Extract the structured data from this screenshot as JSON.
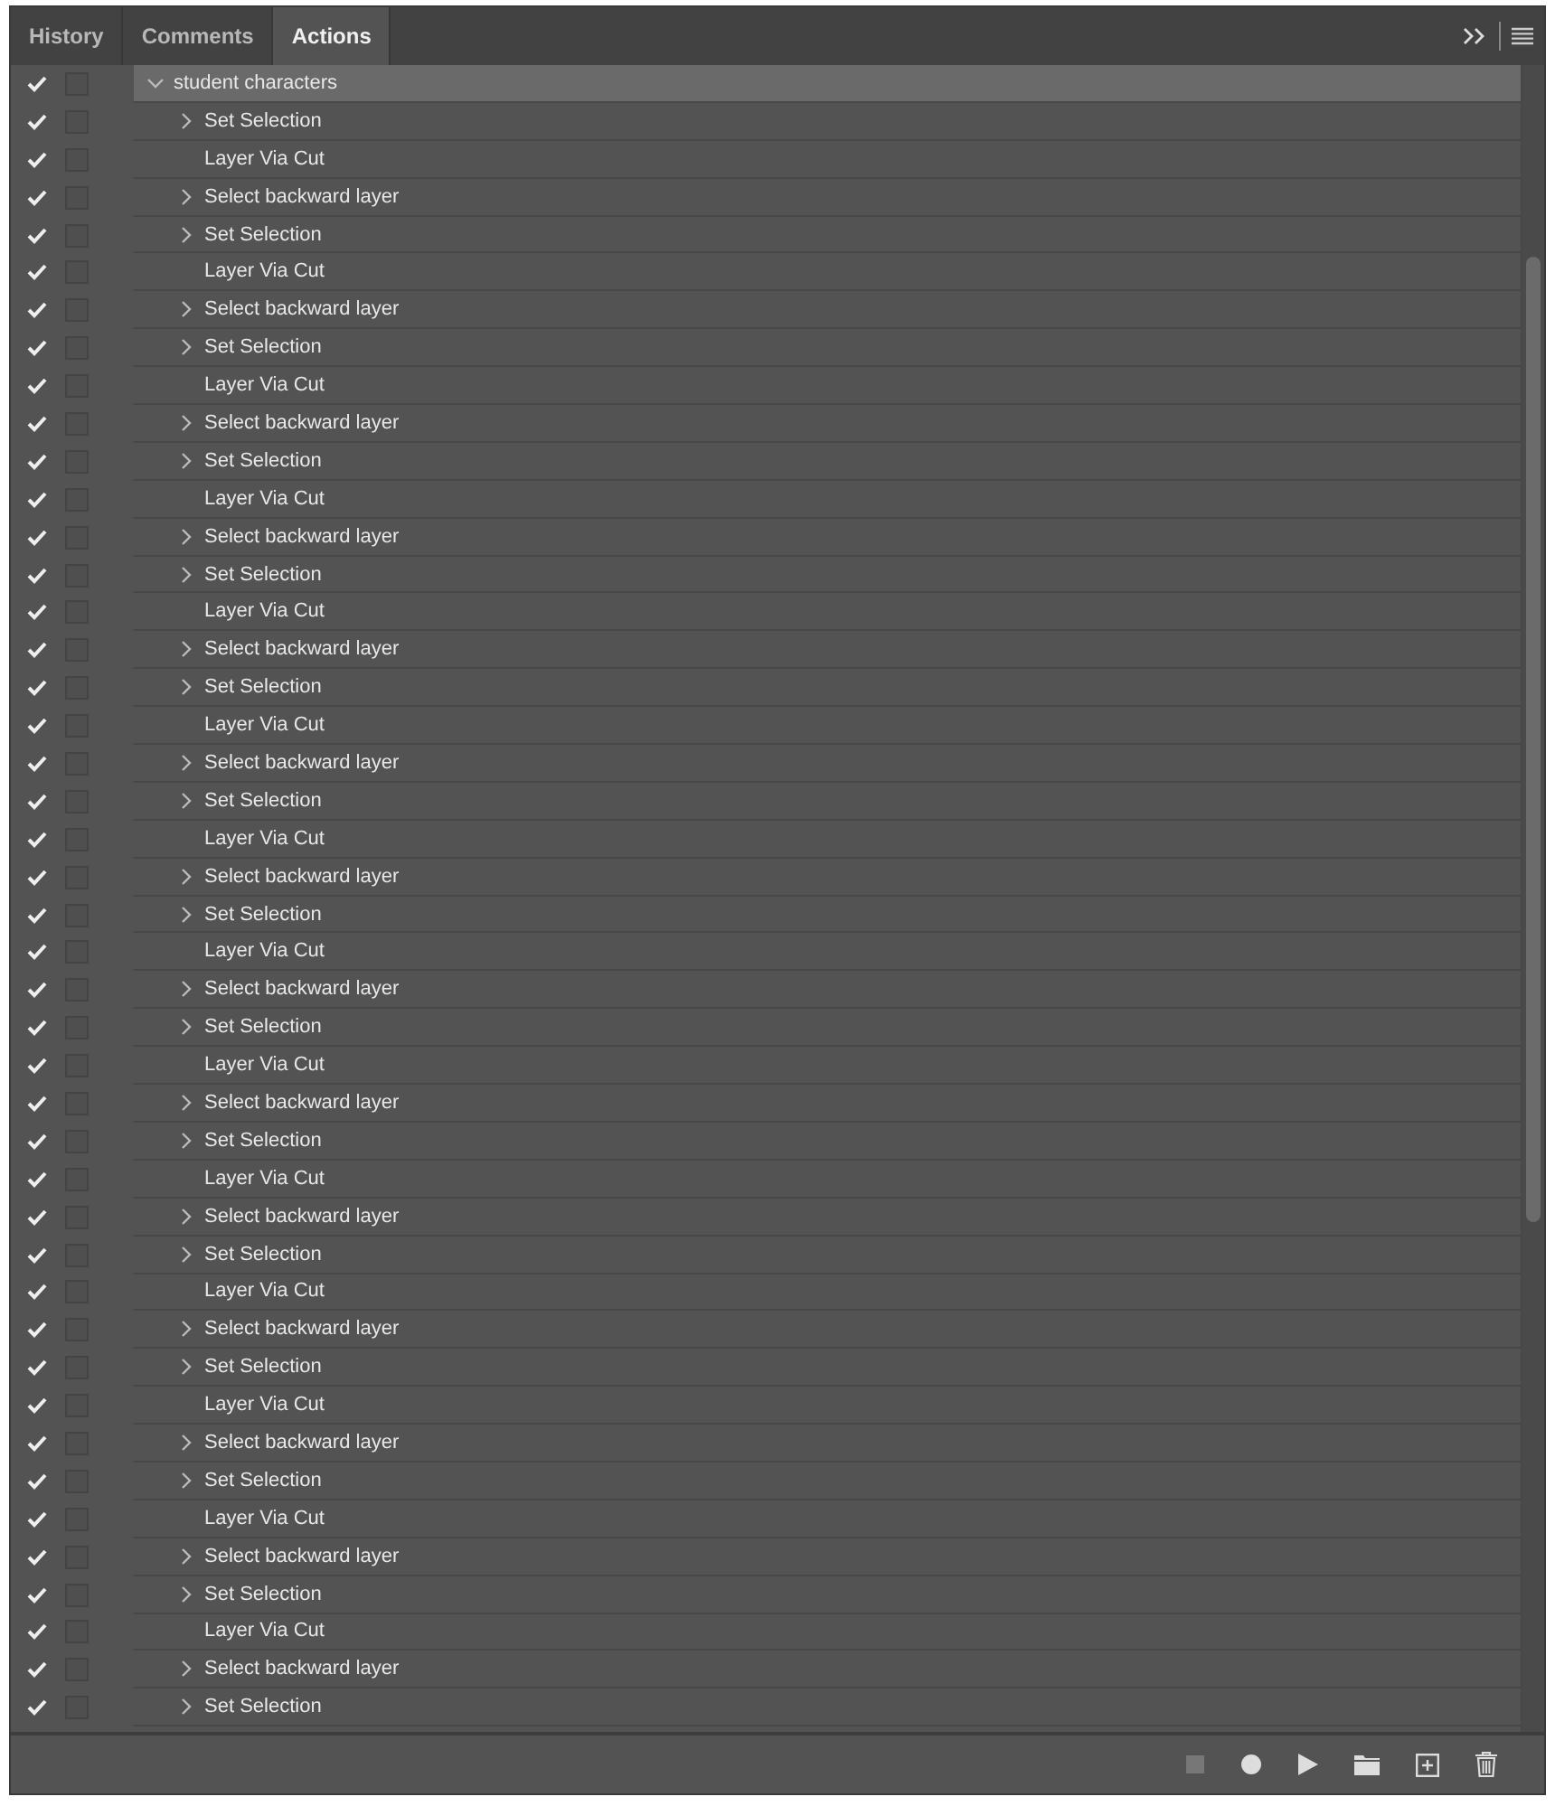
{
  "tabs": [
    {
      "label": "History",
      "selected": false
    },
    {
      "label": "Comments",
      "selected": false
    },
    {
      "label": "Actions",
      "selected": true
    }
  ],
  "actions": [
    {
      "name": "student characters",
      "checked": true,
      "expanded": true,
      "selected": true,
      "children": [
        {
          "name": "Set Selection",
          "checked": true,
          "expandable": true
        },
        {
          "name": "Layer Via Cut",
          "checked": true,
          "expandable": false
        },
        {
          "name": "Select backward layer",
          "checked": true,
          "expandable": true
        },
        {
          "name": "Set Selection",
          "checked": true,
          "expandable": true
        },
        {
          "name": "Layer Via Cut",
          "checked": true,
          "expandable": false
        },
        {
          "name": "Select backward layer",
          "checked": true,
          "expandable": true
        },
        {
          "name": "Set Selection",
          "checked": true,
          "expandable": true
        },
        {
          "name": "Layer Via Cut",
          "checked": true,
          "expandable": false
        },
        {
          "name": "Select backward layer",
          "checked": true,
          "expandable": true
        },
        {
          "name": "Set Selection",
          "checked": true,
          "expandable": true
        },
        {
          "name": "Layer Via Cut",
          "checked": true,
          "expandable": false
        },
        {
          "name": "Select backward layer",
          "checked": true,
          "expandable": true
        },
        {
          "name": "Set Selection",
          "checked": true,
          "expandable": true
        },
        {
          "name": "Layer Via Cut",
          "checked": true,
          "expandable": false
        },
        {
          "name": "Select backward layer",
          "checked": true,
          "expandable": true
        },
        {
          "name": "Set Selection",
          "checked": true,
          "expandable": true
        },
        {
          "name": "Layer Via Cut",
          "checked": true,
          "expandable": false
        },
        {
          "name": "Select backward layer",
          "checked": true,
          "expandable": true
        },
        {
          "name": "Set Selection",
          "checked": true,
          "expandable": true
        },
        {
          "name": "Layer Via Cut",
          "checked": true,
          "expandable": false
        },
        {
          "name": "Select backward layer",
          "checked": true,
          "expandable": true
        },
        {
          "name": "Set Selection",
          "checked": true,
          "expandable": true
        },
        {
          "name": "Layer Via Cut",
          "checked": true,
          "expandable": false
        },
        {
          "name": "Select backward layer",
          "checked": true,
          "expandable": true
        },
        {
          "name": "Set Selection",
          "checked": true,
          "expandable": true
        },
        {
          "name": "Layer Via Cut",
          "checked": true,
          "expandable": false
        },
        {
          "name": "Select backward layer",
          "checked": true,
          "expandable": true
        },
        {
          "name": "Set Selection",
          "checked": true,
          "expandable": true
        },
        {
          "name": "Layer Via Cut",
          "checked": true,
          "expandable": false
        },
        {
          "name": "Select backward layer",
          "checked": true,
          "expandable": true
        },
        {
          "name": "Set Selection",
          "checked": true,
          "expandable": true
        },
        {
          "name": "Layer Via Cut",
          "checked": true,
          "expandable": false
        },
        {
          "name": "Select backward layer",
          "checked": true,
          "expandable": true
        },
        {
          "name": "Set Selection",
          "checked": true,
          "expandable": true
        },
        {
          "name": "Layer Via Cut",
          "checked": true,
          "expandable": false
        },
        {
          "name": "Select backward layer",
          "checked": true,
          "expandable": true
        },
        {
          "name": "Set Selection",
          "checked": true,
          "expandable": true
        },
        {
          "name": "Layer Via Cut",
          "checked": true,
          "expandable": false
        },
        {
          "name": "Select backward layer",
          "checked": true,
          "expandable": true
        },
        {
          "name": "Set Selection",
          "checked": true,
          "expandable": true
        },
        {
          "name": "Layer Via Cut",
          "checked": true,
          "expandable": false
        },
        {
          "name": "Select backward layer",
          "checked": true,
          "expandable": true
        },
        {
          "name": "Set Selection",
          "checked": true,
          "expandable": true
        }
      ]
    }
  ]
}
